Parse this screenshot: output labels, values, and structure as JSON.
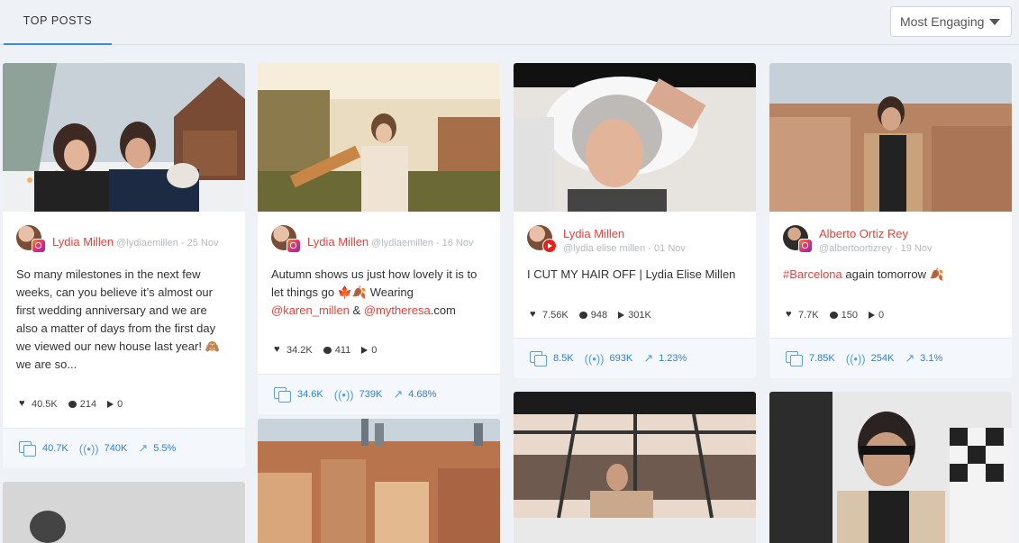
{
  "header": {
    "tab_label": "TOP POSTS",
    "sort": {
      "selected": "Most Engaging"
    }
  },
  "icons": {
    "like": "heart-icon",
    "comment": "comment-icon",
    "views": "play-icon",
    "engagement": "documents-icon",
    "reach": "broadcast-icon",
    "rate": "trend-icon"
  },
  "colors": {
    "accent": "#e8403a",
    "link": "#2e7fd6",
    "tab_underline": "#3b8bdb"
  },
  "posts": [
    {
      "author": "Lydia Millen",
      "handle": "@lydiaemillen - 25 Nov",
      "platform": "instagram",
      "text_parts": [
        "So many milestones in the next few weeks, can you believe it’s almost our first wedding anniversary and we are also a matter of days from the first day we viewed our new house last year! 🙈 we are so..."
      ],
      "likes": "40.5K",
      "comments": "214",
      "views": "0",
      "engagement": "40.7K",
      "reach": "740K",
      "rate": "5.5%"
    },
    {
      "author": "Lydia Millen",
      "handle": "@lydiaemillen - 16 Nov",
      "platform": "instagram",
      "text_a": "Autumn shows us just how lovely it is to let things go 🍁🍂 Wearing ",
      "mention1": "@karen_millen",
      "text_b": " & ",
      "mention2": "@mytheresa",
      "text_c": ".com",
      "likes": "34.2K",
      "comments": "411",
      "views": "0",
      "engagement": "34.6K",
      "reach": "739K",
      "rate": "4.68%"
    },
    {
      "author": "Lydia Millen",
      "handle": "@lydia elise millen - 01 Nov",
      "platform": "youtube",
      "text": "I CUT MY HAIR OFF | Lydia Elise Millen",
      "likes": "7.56K",
      "comments": "948",
      "views": "301K",
      "engagement": "8.5K",
      "reach": "693K",
      "rate": "1.23%"
    },
    {
      "author": "Alberto Ortiz Rey",
      "handle": "@albertoortizrey - 19 Nov",
      "platform": "instagram",
      "hashtag": "#Barcelona",
      "text": " again tomorrow 🍂",
      "likes": "7.7K",
      "comments": "150",
      "views": "0",
      "engagement": "7.85K",
      "reach": "254K",
      "rate": "3.1%"
    }
  ]
}
